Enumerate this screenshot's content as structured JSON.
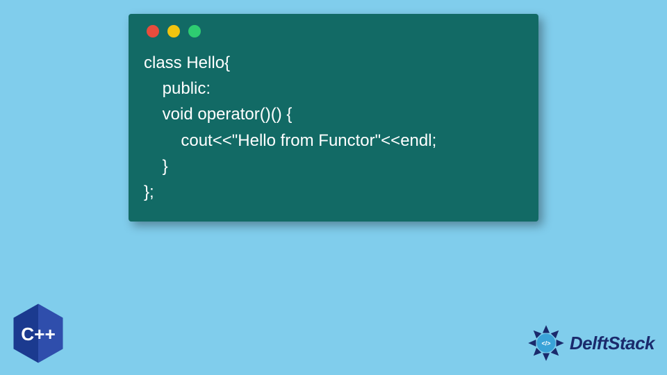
{
  "window": {
    "dot_colors": {
      "red": "#e84c3d",
      "yellow": "#f1c40f",
      "green": "#2ecc71"
    },
    "bg": "#126a65"
  },
  "code": {
    "lines": [
      "class Hello{",
      "    public:",
      "    void operator()() {",
      "        cout<<\"Hello from Functor\"<<endl;",
      "    }",
      "};"
    ]
  },
  "cpp_badge": {
    "label": "C++",
    "fill": "#1b3a8f",
    "accent": "#3d5bbf"
  },
  "delft": {
    "text": "DelftStack",
    "color": "#1a2a6c",
    "tag_symbol": "</>"
  },
  "page_bg": "#80cdec"
}
